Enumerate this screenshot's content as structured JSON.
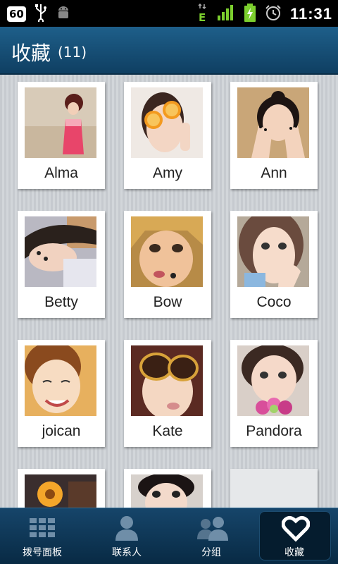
{
  "status_bar": {
    "badge": "60",
    "network": "E",
    "time": "11:31"
  },
  "header": {
    "title": "收藏",
    "count": "(11)"
  },
  "contacts": [
    {
      "name": "Alma"
    },
    {
      "name": "Amy"
    },
    {
      "name": "Ann"
    },
    {
      "name": "Betty"
    },
    {
      "name": "Bow"
    },
    {
      "name": "Coco"
    },
    {
      "name": "joican"
    },
    {
      "name": "Kate"
    },
    {
      "name": "Pandora"
    },
    {
      "name": ""
    },
    {
      "name": ""
    },
    {
      "name": ""
    }
  ],
  "bottom_nav": {
    "items": [
      {
        "label": "拨号面板",
        "icon": "dialpad-icon"
      },
      {
        "label": "联系人",
        "icon": "person-icon"
      },
      {
        "label": "分组",
        "icon": "group-icon"
      },
      {
        "label": "收藏",
        "icon": "heart-icon"
      }
    ],
    "active_index": 3
  },
  "colors": {
    "header_bg": "#1e5f8a",
    "nav_bg": "#0f3a5c"
  }
}
